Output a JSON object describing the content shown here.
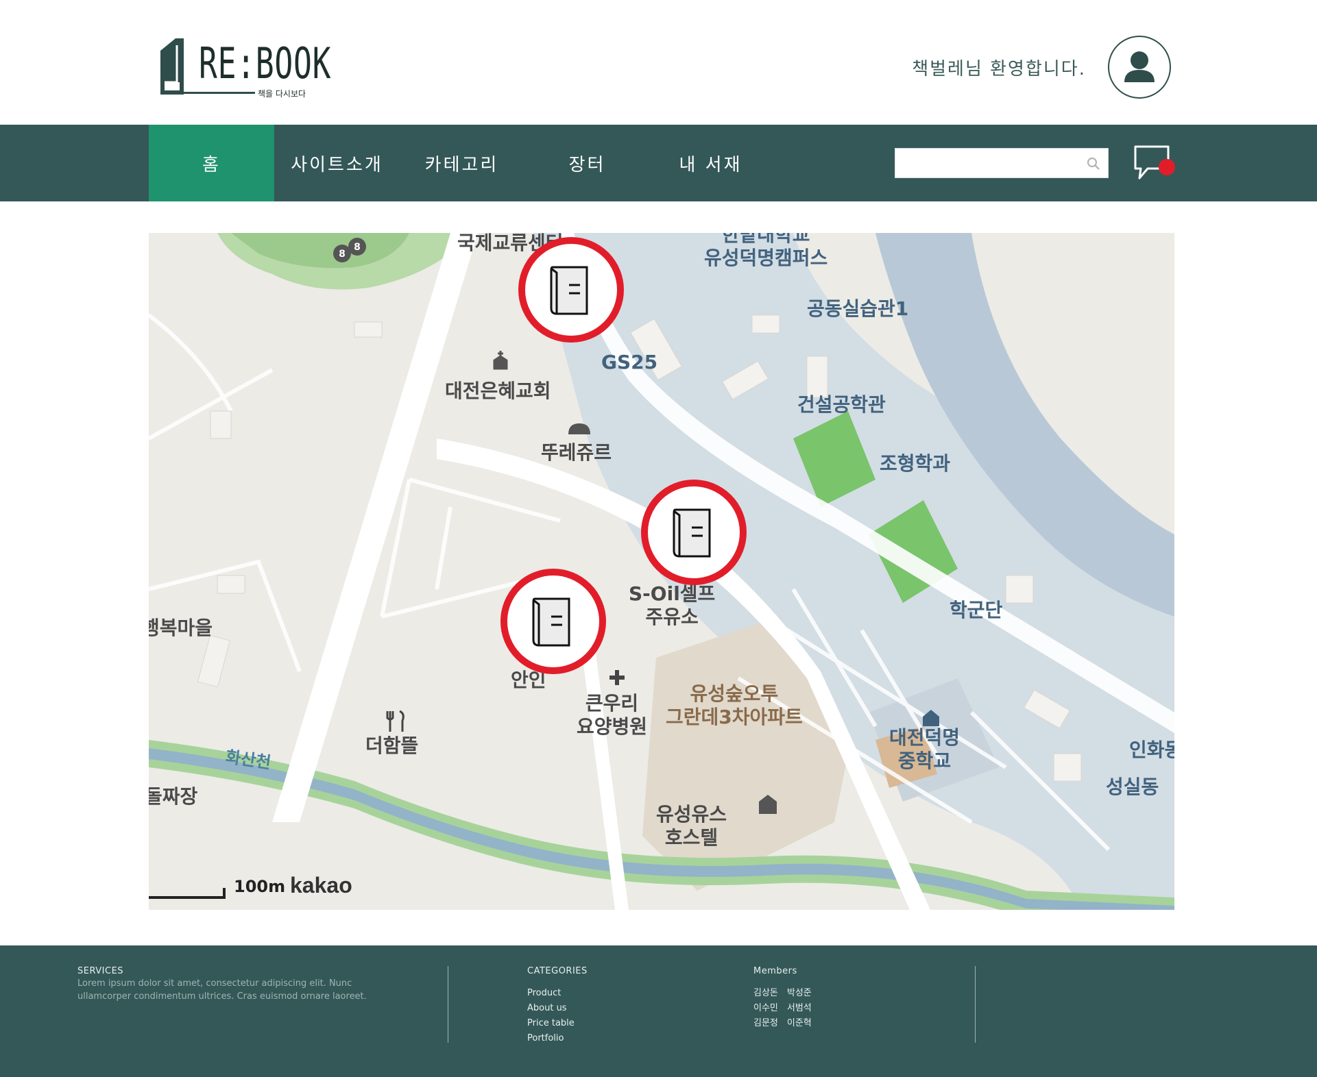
{
  "header": {
    "logo_text": "RE:BOOK",
    "logo_sub": "책을 다시보다",
    "welcome": "책벌레님 환영합니다."
  },
  "nav": {
    "items": [
      {
        "label": "홈",
        "active": true
      },
      {
        "label": "사이트소개",
        "active": false
      },
      {
        "label": "카테고리",
        "active": false
      },
      {
        "label": "장터",
        "active": false
      },
      {
        "label": "내 서재",
        "active": false
      }
    ],
    "search_placeholder": ""
  },
  "map": {
    "labels": {
      "international": "국제교류센터",
      "campus": "한밭대학교\n유성덕명캠퍼스",
      "practice": "공동실습관1",
      "gs25": "GS25",
      "church": "대전은혜교회",
      "bakery": "뚜레쥬르",
      "construction": "건설공학관",
      "landscape": "조형학과",
      "station": "S-Oil셀프\n주유소",
      "haengbok": "행복마을",
      "hospital": "큰우리\n요양병원",
      "apartment": "유성숲오투\n그란데3차아파트",
      "military": "학군단",
      "school": "대전덕명\n중학교",
      "restaurant": "더함뜰",
      "river": "화산천",
      "hostel": "유성유스\n호스텔",
      "inhwa": "인화동",
      "seongsil": "성실동",
      "doljjak": "돌짜장",
      "anin": "안인"
    },
    "markers": 3,
    "scale": "100m",
    "attribution": "kakao"
  },
  "footer": {
    "services_title": "SERVICES",
    "services_text": "Lorem ipsum dolor sit amet, consectetur adipiscing elit. Nunc ullamcorper condimentum ultrices. Cras euismod ornare laoreet.",
    "categories_title": "CATEGORIES",
    "categories": [
      "Product",
      "About us",
      "Price table",
      "Portfolio"
    ],
    "members_title": "Members",
    "members": [
      "김상돈　박성준",
      "이수민　서범석",
      "김문정　이준혁"
    ]
  },
  "colors": {
    "nav_bg": "#345858",
    "nav_active": "#1f936e",
    "marker_ring": "#e21d2a",
    "notification": "#e21d2a"
  }
}
